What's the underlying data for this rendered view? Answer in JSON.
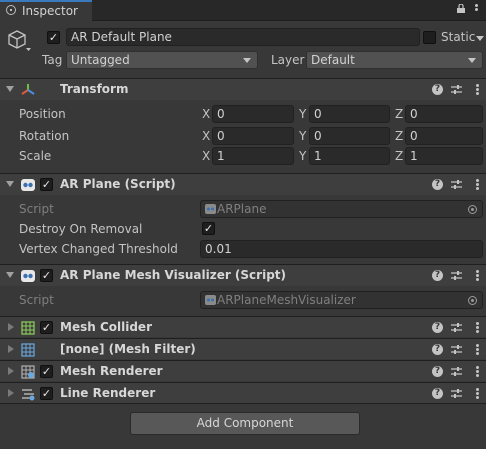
{
  "tab": {
    "title": "Inspector"
  },
  "gameobject": {
    "name": "AR Default Plane",
    "static_label": "Static",
    "tag_label": "Tag",
    "tag_value": "Untagged",
    "layer_label": "Layer",
    "layer_value": "Default"
  },
  "transform": {
    "title": "Transform",
    "rows": [
      {
        "label": "Position",
        "x": "0",
        "y": "0",
        "z": "0"
      },
      {
        "label": "Rotation",
        "x": "0",
        "y": "0",
        "z": "0"
      },
      {
        "label": "Scale",
        "x": "1",
        "y": "1",
        "z": "1"
      }
    ],
    "axes": [
      "X",
      "Y",
      "Z"
    ]
  },
  "ar_plane": {
    "title": "AR Plane (Script)",
    "script_label": "Script",
    "script_value": "ARPlane",
    "destroy_label": "Destroy On Removal",
    "destroy_checked": "✓",
    "threshold_label": "Vertex Changed Threshold",
    "threshold_value": "0.01"
  },
  "mesh_visualizer": {
    "title": "AR Plane Mesh Visualizer (Script)",
    "script_label": "Script",
    "script_value": "ARPlaneMeshVisualizer"
  },
  "components": [
    {
      "title": "Mesh Collider",
      "icon": "mesh-collider-icon"
    },
    {
      "title": "[none] (Mesh Filter)",
      "icon": "mesh-filter-icon"
    },
    {
      "title": "Mesh Renderer",
      "icon": "mesh-renderer-icon"
    },
    {
      "title": "Line Renderer",
      "icon": "line-renderer-icon"
    }
  ],
  "add_component_label": "Add Component",
  "colors": {
    "accent": "#3a79bb",
    "background": "#383838",
    "header": "#3e3e3e"
  }
}
